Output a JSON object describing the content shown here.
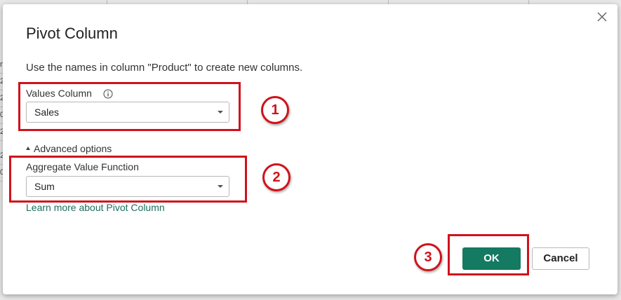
{
  "background_sheet": {
    "row_fragments": [
      "n",
      "2",
      "2",
      "0",
      "2",
      "2",
      "0"
    ]
  },
  "dialog": {
    "title": "Pivot Column",
    "description": "Use the names in column \"Product\" to create new columns.",
    "values_column": {
      "label": "Values Column",
      "selected": "Sales"
    },
    "advanced_options_label": "Advanced options",
    "aggregate": {
      "label": "Aggregate Value Function",
      "selected": "Sum"
    },
    "learn_more": "Learn more about Pivot Column",
    "ok_label": "OK",
    "cancel_label": "Cancel"
  },
  "annotations": {
    "step1": "1",
    "step2": "2",
    "step3": "3",
    "color": "#d0121b"
  },
  "colors": {
    "primary_button": "#147a62",
    "link": "#1e6e5f"
  }
}
